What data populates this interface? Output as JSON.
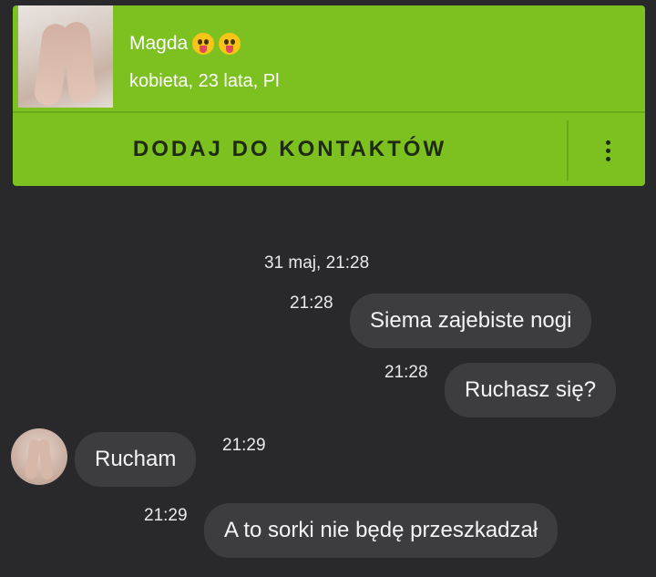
{
  "profile": {
    "name": "Magda",
    "details": "kobieta, 23 lata, Pl",
    "emojis": [
      "tongue-out-emoji",
      "tongue-out-emoji"
    ]
  },
  "actions": {
    "add_contact_label": "DODAJ DO KONTAKTÓW",
    "more_icon": "vertical-dots-icon"
  },
  "chat": {
    "date_label": "31 maj, 21:28",
    "messages": [
      {
        "direction": "outgoing",
        "time": "21:28",
        "text": "Siema zajebiste nogi"
      },
      {
        "direction": "outgoing",
        "time": "21:28",
        "text": "Ruchasz się?"
      },
      {
        "direction": "incoming",
        "time": "21:29",
        "text": "Rucham"
      },
      {
        "direction": "outgoing",
        "time": "21:29",
        "text": "A to sorki nie będę przeszkadzał"
      }
    ]
  },
  "colors": {
    "accent": "#7cc11f",
    "background": "#29292b",
    "bubble": "#3d3d40",
    "text": "#f4f4f4"
  }
}
